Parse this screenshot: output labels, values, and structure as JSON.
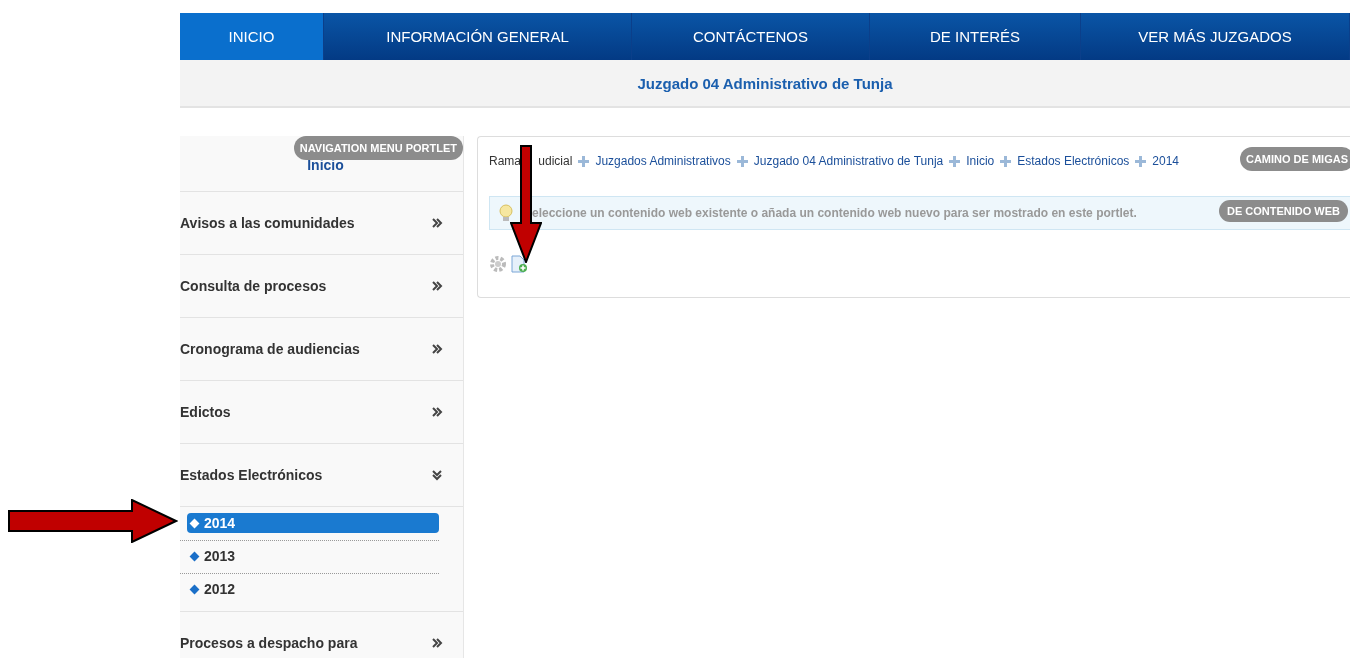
{
  "top_nav": [
    {
      "label": "INICIO",
      "selected": true
    },
    {
      "label": "INFORMACIÓN GENERAL",
      "selected": false
    },
    {
      "label": "CONTÁCTENOS",
      "selected": false
    },
    {
      "label": "DE INTERÉS",
      "selected": false
    },
    {
      "label": "VER MÁS JUZGADOS",
      "selected": false
    }
  ],
  "site_title": "Juzgado 04 Administrativo de Tunja",
  "sidebar": {
    "badge": "NAVIGATION MENU PORTLET",
    "heading": "Inicio",
    "items": [
      {
        "label": "Avisos a las comunidades",
        "expanded": false
      },
      {
        "label": "Consulta de procesos",
        "expanded": false
      },
      {
        "label": "Cronograma de audiencias",
        "expanded": false
      },
      {
        "label": "Edictos",
        "expanded": false
      },
      {
        "label": "Estados Electrónicos",
        "expanded": true,
        "children": [
          {
            "label": "2014",
            "selected": true
          },
          {
            "label": "2013",
            "selected": false
          },
          {
            "label": "2012",
            "selected": false
          }
        ]
      },
      {
        "label": "Procesos a despacho para",
        "expanded": false
      }
    ]
  },
  "breadcrumb": {
    "badge": "CAMINO DE MIGAS",
    "items": [
      "Rama udicial",
      "Juzgados Administrativos",
      "Juzgado 04 Administrativo de Tunja",
      "Inicio",
      "Estados Electrónicos",
      "2014"
    ]
  },
  "content_viewer": {
    "badge": "DE CONTENIDO WEB",
    "message": "eleccione un contenido web existente o añada un contenido web nuevo para ser mostrado en este portlet."
  }
}
